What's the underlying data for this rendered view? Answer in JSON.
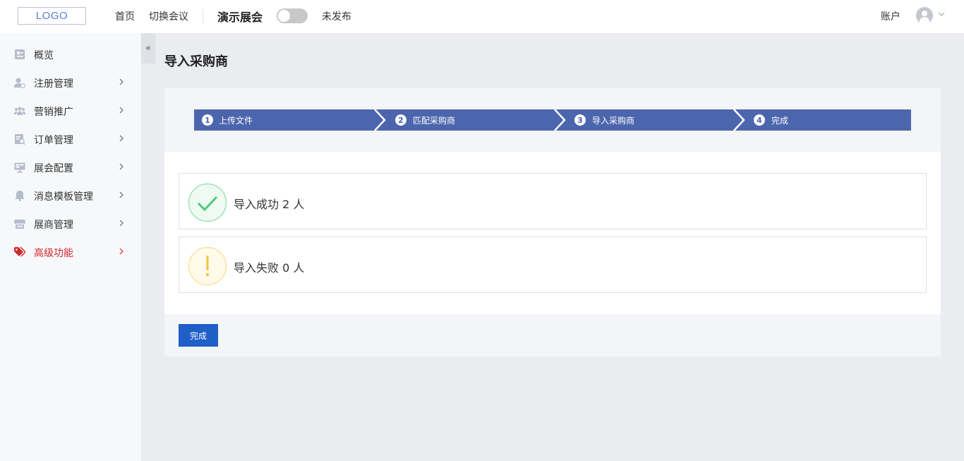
{
  "header": {
    "logo": "LOGO",
    "nav_home": "首页",
    "nav_switch": "切换会议",
    "expo_name": "演示展会",
    "publish_status": "未发布",
    "account": "账户"
  },
  "sidebar": {
    "items": [
      {
        "label": "概览",
        "icon": "overview-icon"
      },
      {
        "label": "注册管理",
        "icon": "user-register-icon"
      },
      {
        "label": "营销推广",
        "icon": "group-icon"
      },
      {
        "label": "订单管理",
        "icon": "order-icon"
      },
      {
        "label": "展会配置",
        "icon": "monitor-icon"
      },
      {
        "label": "消息模板管理",
        "icon": "bell-icon"
      },
      {
        "label": "展商管理",
        "icon": "store-icon"
      },
      {
        "label": "高级功能",
        "icon": "tag-icon"
      }
    ],
    "active_index": 7,
    "collapse_symbol": "«"
  },
  "page": {
    "title": "导入采购商"
  },
  "steps": [
    {
      "num": "1",
      "label": "上传文件"
    },
    {
      "num": "2",
      "label": "匹配采购商"
    },
    {
      "num": "3",
      "label": "导入采购商"
    },
    {
      "num": "4",
      "label": "完成"
    }
  ],
  "results": {
    "success": "导入成功 2 人",
    "fail": "导入失败 0 人"
  },
  "footer": {
    "done_label": "完成"
  },
  "colors": {
    "step_band": "#4c66ad",
    "primary_button": "#1f5fc7",
    "active_menu": "#d0282e",
    "success": "#4dc97e",
    "warning": "#f5c242"
  }
}
